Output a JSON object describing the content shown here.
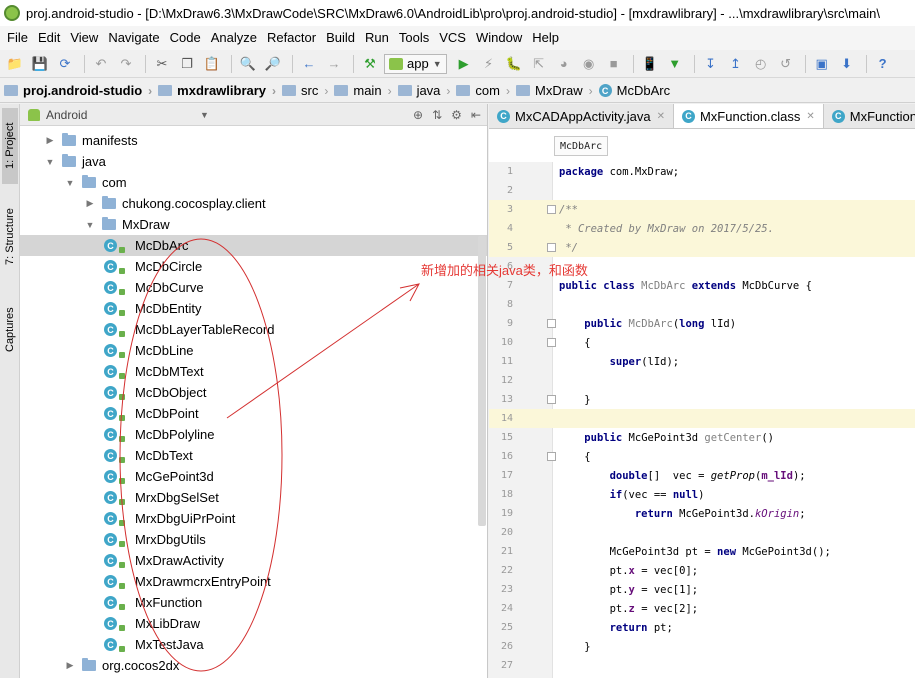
{
  "window": {
    "title": "proj.android-studio - [D:\\MxDraw6.3\\MxDrawCode\\SRC\\MxDraw6.0\\AndroidLib\\pro\\proj.android-studio] - [mxdrawlibrary] - ...\\mxdrawlibrary\\src\\main\\"
  },
  "menu": [
    "File",
    "Edit",
    "View",
    "Navigate",
    "Code",
    "Analyze",
    "Refactor",
    "Build",
    "Run",
    "Tools",
    "VCS",
    "Window",
    "Help"
  ],
  "toolbar": {
    "run_config": "app"
  },
  "breadcrumb": [
    {
      "label": "proj.android-studio",
      "kind": "project"
    },
    {
      "label": "mxdrawlibrary",
      "kind": "module"
    },
    {
      "label": "src",
      "kind": "folder"
    },
    {
      "label": "main",
      "kind": "folder"
    },
    {
      "label": "java",
      "kind": "folder"
    },
    {
      "label": "com",
      "kind": "folder"
    },
    {
      "label": "MxDraw",
      "kind": "folder"
    },
    {
      "label": "McDbArc",
      "kind": "class"
    }
  ],
  "side_tabs": [
    "1: Project",
    "7: Structure",
    "Captures"
  ],
  "project": {
    "view_mode": "Android",
    "tree": [
      {
        "label": "manifests",
        "kind": "folder",
        "arrow": "right",
        "indent": 1
      },
      {
        "label": "java",
        "kind": "folder",
        "arrow": "down",
        "indent": 1
      },
      {
        "label": "com",
        "kind": "folder",
        "arrow": "down",
        "indent": 2
      },
      {
        "label": "chukong.cocosplay.client",
        "kind": "folder",
        "arrow": "right",
        "indent": 3
      },
      {
        "label": "MxDraw",
        "kind": "folder",
        "arrow": "down",
        "indent": 3
      },
      {
        "label": "McDbArc",
        "kind": "class",
        "indent": 4,
        "selected": true
      },
      {
        "label": "McDbCircle",
        "kind": "class",
        "indent": 4
      },
      {
        "label": "McDbCurve",
        "kind": "class",
        "indent": 4
      },
      {
        "label": "McDbEntity",
        "kind": "class",
        "indent": 4
      },
      {
        "label": "McDbLayerTableRecord",
        "kind": "class",
        "indent": 4
      },
      {
        "label": "McDbLine",
        "kind": "class",
        "indent": 4
      },
      {
        "label": "McDbMText",
        "kind": "class",
        "indent": 4
      },
      {
        "label": "McDbObject",
        "kind": "class",
        "indent": 4
      },
      {
        "label": "McDbPoint",
        "kind": "class",
        "indent": 4
      },
      {
        "label": "McDbPolyline",
        "kind": "class",
        "indent": 4
      },
      {
        "label": "McDbText",
        "kind": "class",
        "indent": 4
      },
      {
        "label": "McGePoint3d",
        "kind": "class",
        "indent": 4
      },
      {
        "label": "MrxDbgSelSet",
        "kind": "class",
        "indent": 4
      },
      {
        "label": "MrxDbgUiPrPoint",
        "kind": "class",
        "indent": 4
      },
      {
        "label": "MrxDbgUtils",
        "kind": "class",
        "indent": 4
      },
      {
        "label": "MxDrawActivity",
        "kind": "class",
        "indent": 4
      },
      {
        "label": "MxDrawmcrxEntryPoint",
        "kind": "class",
        "indent": 4
      },
      {
        "label": "MxFunction",
        "kind": "class",
        "indent": 4
      },
      {
        "label": "MxLibDraw",
        "kind": "class",
        "indent": 4
      },
      {
        "label": "MxTestJava",
        "kind": "class",
        "indent": 4
      },
      {
        "label": "org.cocos2dx",
        "kind": "folder",
        "arrow": "right",
        "indent": 2
      }
    ]
  },
  "editor": {
    "tabs": [
      {
        "label": "MxCADAppActivity.java",
        "active": false
      },
      {
        "label": "MxFunction.class",
        "active": true
      },
      {
        "label": "MxFunction.",
        "active": false
      }
    ],
    "structure_hint": "McDbArc",
    "lines": [
      {
        "n": "1",
        "parts": [
          [
            "kw",
            "package"
          ],
          [
            "",
            " com.MxDraw;"
          ]
        ]
      },
      {
        "n": "2",
        "parts": []
      },
      {
        "n": "3",
        "parts": [
          [
            "cm",
            "/**"
          ]
        ],
        "hl": true
      },
      {
        "n": "4",
        "parts": [
          [
            "cm",
            " * Created by MxDraw on 2017/5/25."
          ]
        ],
        "hl": true
      },
      {
        "n": "5",
        "parts": [
          [
            "cm",
            " */"
          ]
        ],
        "hl": true
      },
      {
        "n": "6",
        "parts": []
      },
      {
        "n": "7",
        "parts": [
          [
            "kw",
            "public class"
          ],
          [
            "gr",
            " McDbArc "
          ],
          [
            "kw",
            "extends"
          ],
          [
            "",
            " McDbCurve {"
          ]
        ]
      },
      {
        "n": "8",
        "parts": []
      },
      {
        "n": "9",
        "parts": [
          [
            "",
            "    "
          ],
          [
            "kw",
            "public"
          ],
          [
            "gr",
            " McDbArc"
          ],
          [
            "",
            "("
          ],
          [
            "kw",
            "long"
          ],
          [
            "",
            " lId)"
          ]
        ]
      },
      {
        "n": "10",
        "parts": [
          [
            "",
            "    {"
          ]
        ]
      },
      {
        "n": "11",
        "parts": [
          [
            "",
            "        "
          ],
          [
            "kw",
            "super"
          ],
          [
            "",
            "(lId);"
          ]
        ]
      },
      {
        "n": "12",
        "parts": []
      },
      {
        "n": "13",
        "parts": [
          [
            "",
            "    }"
          ]
        ]
      },
      {
        "n": "14",
        "parts": [],
        "hl": true
      },
      {
        "n": "15",
        "parts": [
          [
            "",
            "    "
          ],
          [
            "kw",
            "public"
          ],
          [
            "",
            " McGePoint3d "
          ],
          [
            "gr",
            "getCenter"
          ],
          [
            "",
            "()"
          ]
        ]
      },
      {
        "n": "16",
        "parts": [
          [
            "",
            "    {"
          ]
        ]
      },
      {
        "n": "17",
        "parts": [
          [
            "",
            "        "
          ],
          [
            "kw",
            "double"
          ],
          [
            "",
            "[]  vec = "
          ],
          [
            "it",
            "getProp"
          ],
          [
            "",
            "("
          ],
          [
            "fld",
            "m_lId"
          ],
          [
            "",
            ");"
          ]
        ]
      },
      {
        "n": "18",
        "parts": [
          [
            "",
            "        "
          ],
          [
            "kw",
            "if"
          ],
          [
            "",
            "(vec == "
          ],
          [
            "kw",
            "null"
          ],
          [
            "",
            ")"
          ]
        ]
      },
      {
        "n": "19",
        "parts": [
          [
            "",
            "            "
          ],
          [
            "kw",
            "return"
          ],
          [
            "",
            " McGePoint3d."
          ],
          [
            "sfld",
            "kOrigin"
          ],
          [
            "",
            ";"
          ]
        ]
      },
      {
        "n": "20",
        "parts": []
      },
      {
        "n": "21",
        "parts": [
          [
            "",
            "        McGePoint3d pt = "
          ],
          [
            "kw",
            "new"
          ],
          [
            "",
            " McGePoint3d();"
          ]
        ]
      },
      {
        "n": "22",
        "parts": [
          [
            "",
            "        pt."
          ],
          [
            "fld",
            "x"
          ],
          [
            "",
            " = vec[0];"
          ]
        ]
      },
      {
        "n": "23",
        "parts": [
          [
            "",
            "        pt."
          ],
          [
            "fld",
            "y"
          ],
          [
            "",
            " = vec[1];"
          ]
        ]
      },
      {
        "n": "24",
        "parts": [
          [
            "",
            "        pt."
          ],
          [
            "fld",
            "z"
          ],
          [
            "",
            " = vec[2];"
          ]
        ]
      },
      {
        "n": "25",
        "parts": [
          [
            "",
            "        "
          ],
          [
            "kw",
            "return"
          ],
          [
            "",
            " pt;"
          ]
        ]
      },
      {
        "n": "26",
        "parts": [
          [
            "",
            "    }"
          ]
        ]
      },
      {
        "n": "27",
        "parts": []
      }
    ]
  },
  "annotation": {
    "text": "新增加的相关java类，和函数",
    "color": "#e53935"
  }
}
